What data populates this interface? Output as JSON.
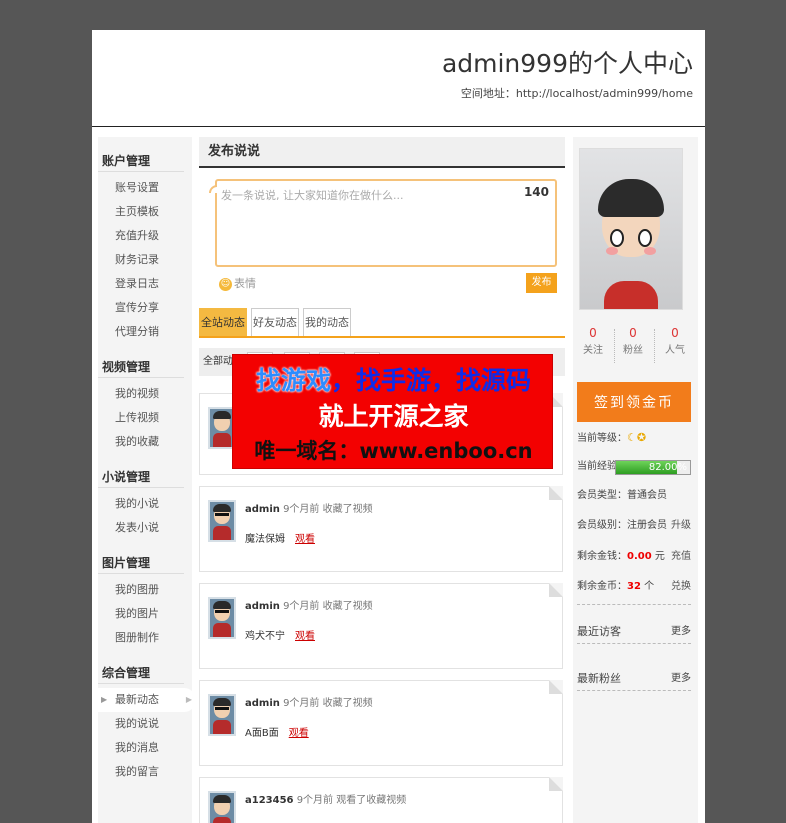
{
  "header": {
    "title": "admin999的个人中心",
    "url_label": "空间地址：",
    "url": "http://localhost/admin999/home"
  },
  "sidebar": {
    "sections": [
      {
        "title": "账户管理",
        "items": [
          "账号设置",
          "主页模板",
          "充值升级",
          "财务记录",
          "登录日志",
          "宣传分享",
          "代理分销"
        ]
      },
      {
        "title": "视频管理",
        "items": [
          "我的视频",
          "上传视频",
          "我的收藏"
        ]
      },
      {
        "title": "小说管理",
        "items": [
          "我的小说",
          "发表小说"
        ]
      },
      {
        "title": "图片管理",
        "items": [
          "我的图册",
          "我的图片",
          "图册制作"
        ]
      },
      {
        "title": "综合管理",
        "items": [
          "最新动态",
          "我的说说",
          "我的消息",
          "我的留言"
        ]
      }
    ],
    "active_item": "最新动态"
  },
  "post": {
    "heading": "发布说说",
    "placeholder": "发一条说说, 让大家知道你在做什么...",
    "counter": "140",
    "emoji_label": "表情",
    "publish_label": "发布"
  },
  "tabs": [
    "全站动态",
    "好友动态",
    "我的动态"
  ],
  "filter": {
    "label": "全部动态"
  },
  "feed": [
    {
      "user": "",
      "meta": "",
      "text": "",
      "view": ""
    },
    {
      "user": "admin",
      "meta": "9个月前 收藏了视频",
      "text": "魔法保姆",
      "view": "观看"
    },
    {
      "user": "admin",
      "meta": "9个月前 收藏了视频",
      "text": "鸡犬不宁",
      "view": "观看"
    },
    {
      "user": "admin",
      "meta": "9个月前 收藏了视频",
      "text": "A面B面",
      "view": "观看"
    },
    {
      "user": "a123456",
      "meta": "9个月前 观看了收藏视频",
      "text": "",
      "view": ""
    }
  ],
  "profile": {
    "stats": [
      {
        "value": "0",
        "label": "关注"
      },
      {
        "value": "0",
        "label": "粉丝"
      },
      {
        "value": "0",
        "label": "人气"
      }
    ],
    "signin_label": "签到领金币",
    "level_label": "当前等级：",
    "exp_label": "当前经验：",
    "exp_percent": "82.00%",
    "exp_fraction": 0.82,
    "member_type_label": "会员类型：普通会员",
    "member_level_label": "会员级别：注册会员",
    "member_level_action": "升级",
    "balance_label": "剩余金钱：",
    "balance_value": "0.00",
    "balance_unit": "元",
    "balance_action": "充值",
    "coins_label": "剩余金币：",
    "coins_value": "32",
    "coins_unit": "个",
    "coins_action": "兑换",
    "recent_visitors": "最近访客",
    "recent_visitors_more": "更多",
    "new_fans": "最新粉丝",
    "new_fans_more": "更多"
  },
  "ad": {
    "line1a": "找游戏",
    "line1b": "，找手游，找源码",
    "line2": "就上开源之家",
    "line3": "唯一域名：www.enboo.cn"
  },
  "colors": {
    "accent": "#f4a21c",
    "signin": "#f27c1b",
    "ad_bg": "#f30101",
    "outer_bg": "#565656"
  }
}
